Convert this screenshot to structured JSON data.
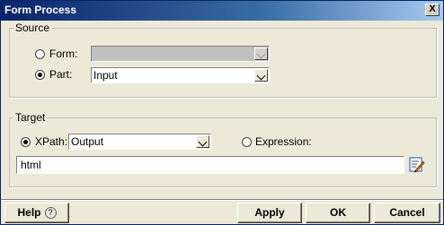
{
  "window": {
    "title": "Form Process",
    "close_label": "X"
  },
  "source": {
    "legend": "Source",
    "form_label": "Form:",
    "form_value": "",
    "part_label": "Part:",
    "part_value": "Input",
    "selected": "part"
  },
  "target": {
    "legend": "Target",
    "xpath_label": "XPath:",
    "xpath_value": "Output",
    "expression_label": "Expression:",
    "expression_value": "html",
    "selected": "xpath"
  },
  "footer": {
    "help_label": "Help",
    "help_icon": "?",
    "apply_label": "Apply",
    "ok_label": "OK",
    "cancel_label": "Cancel"
  }
}
